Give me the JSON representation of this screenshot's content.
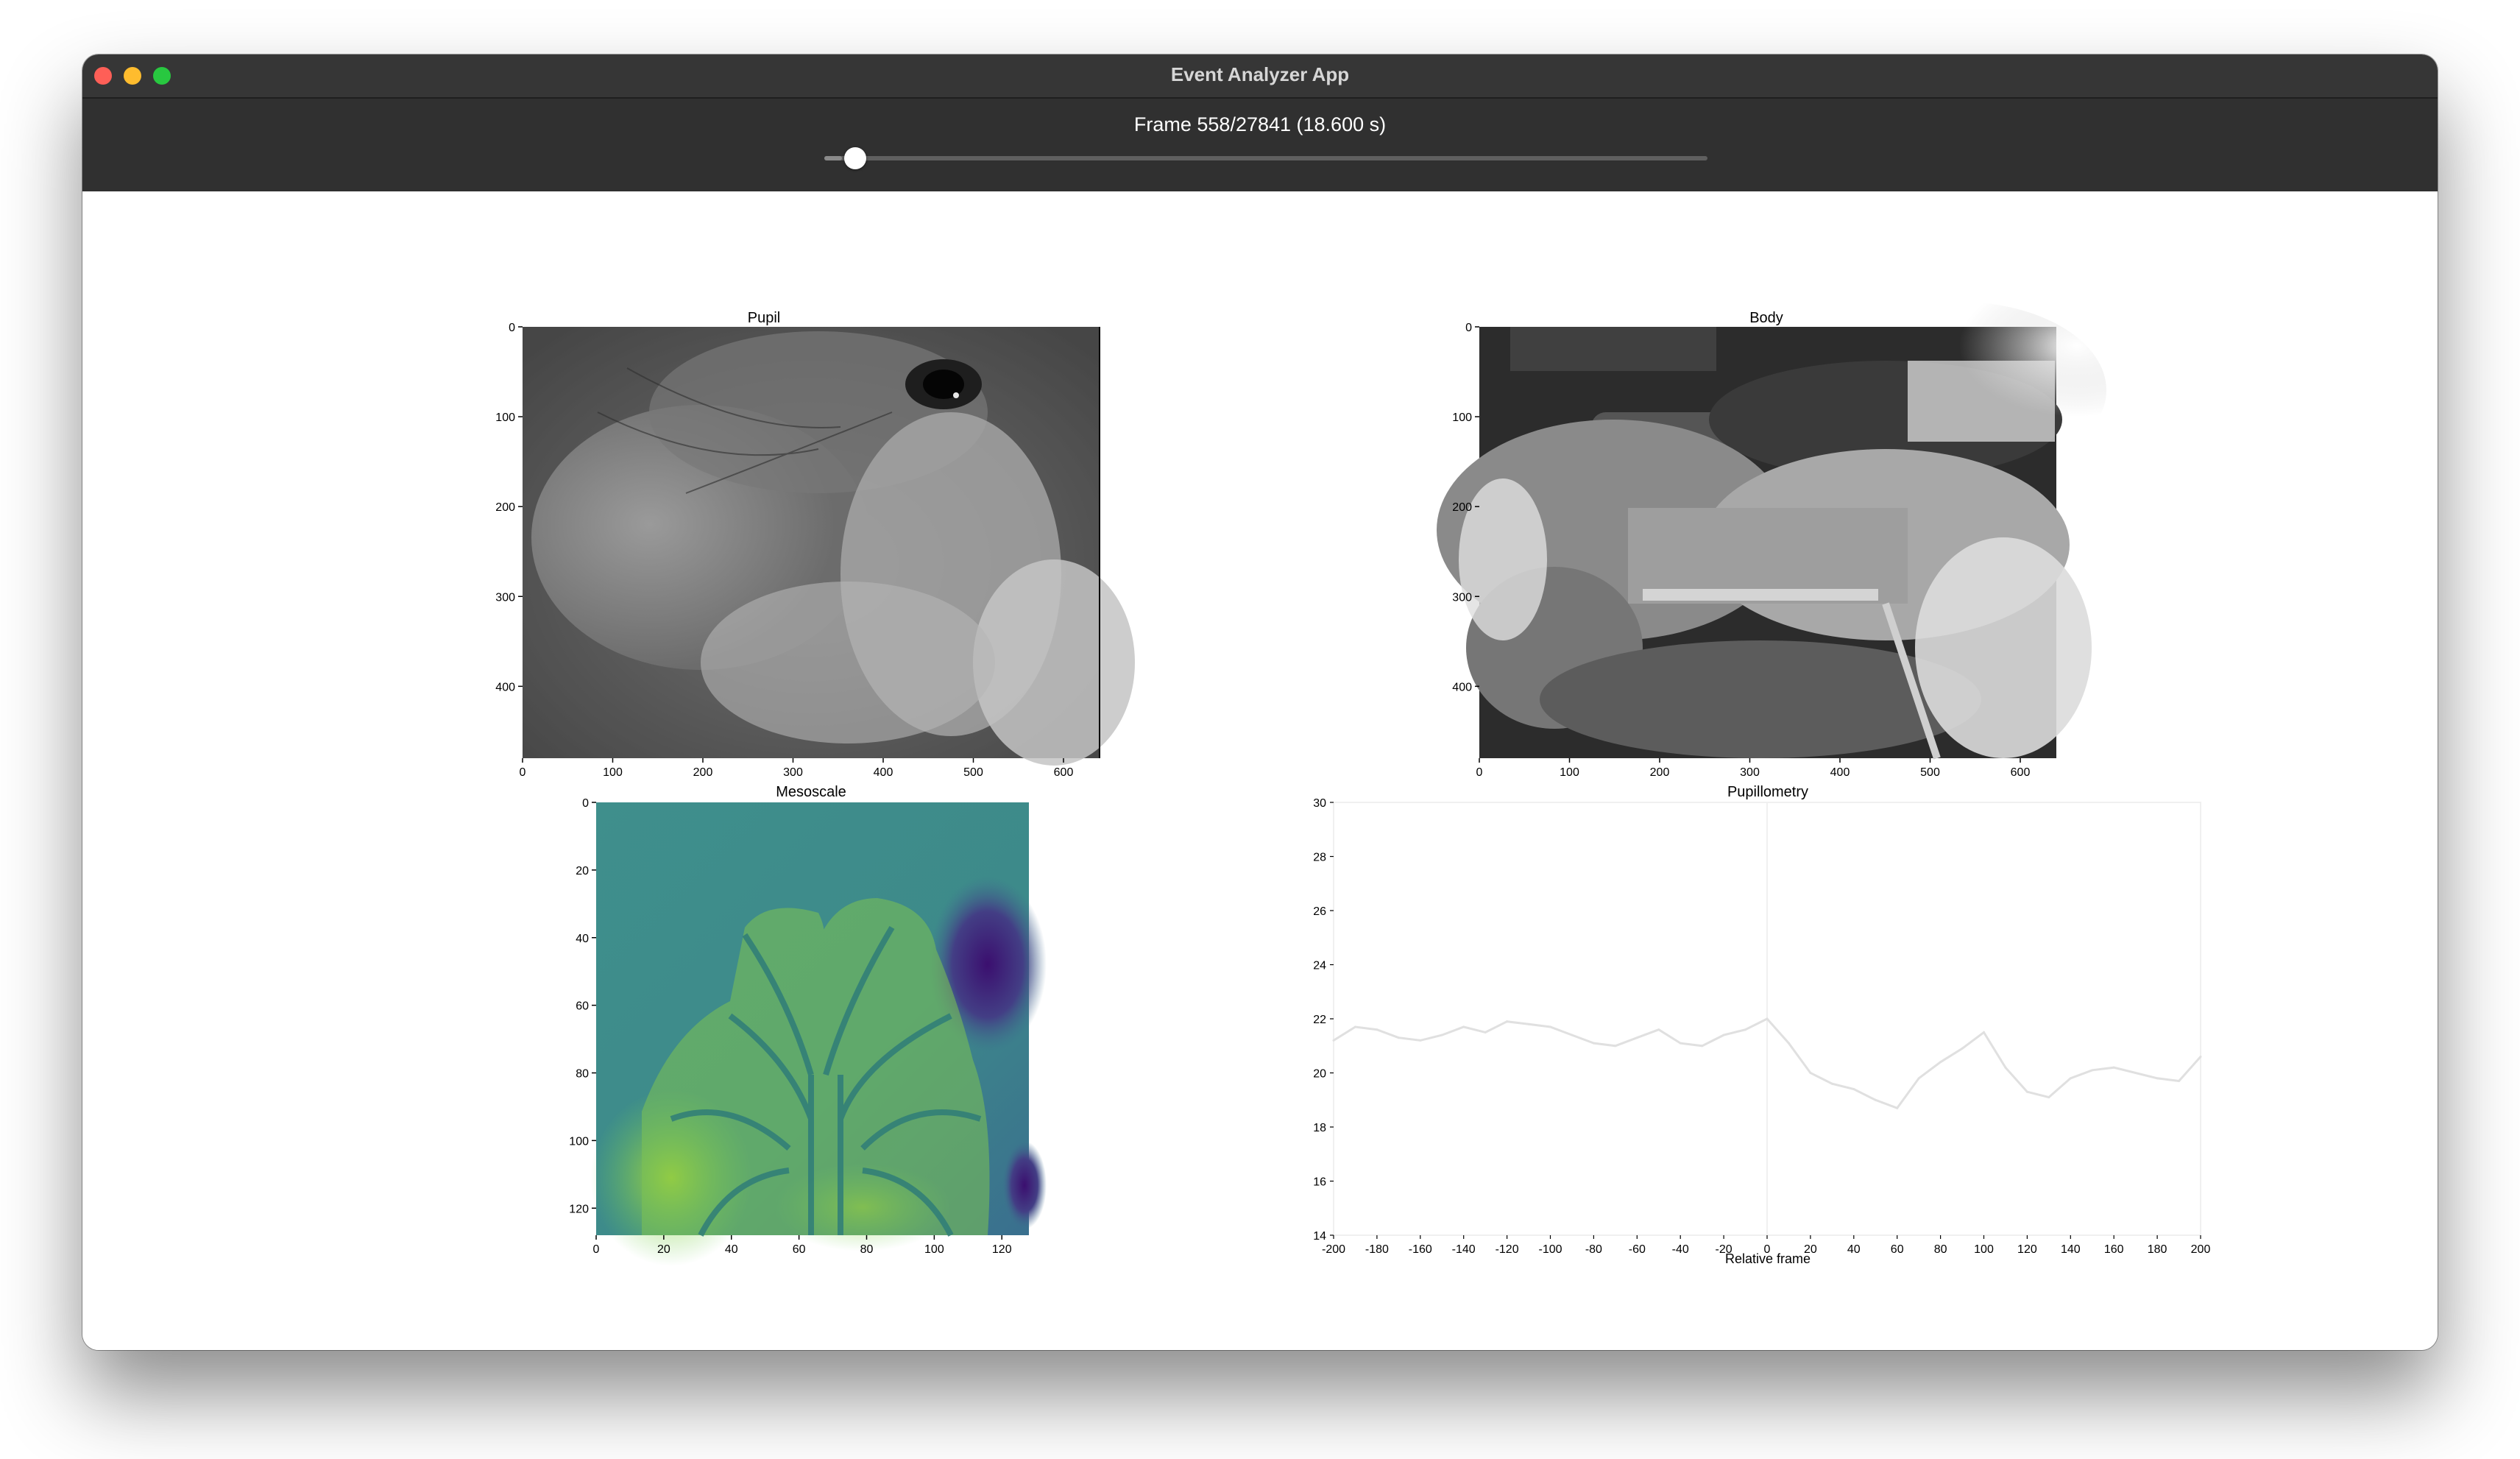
{
  "window": {
    "title": "Event Analyzer App"
  },
  "controls": {
    "frame_label": "Frame 558/27841 (18.600 s)",
    "slider": {
      "current_frame": 558,
      "total_frames": 27841,
      "fraction": 0.02
    }
  },
  "panels": {
    "pupil": {
      "title": "Pupil",
      "xticks": [
        "0",
        "100",
        "200",
        "300",
        "400",
        "500",
        "600"
      ],
      "yticks": [
        "0",
        "100",
        "200",
        "300",
        "400"
      ],
      "xlim": [
        0,
        640
      ],
      "ylim": [
        480,
        0
      ],
      "image": "grayscale close-up of mouse face with eye and whiskers"
    },
    "body": {
      "title": "Body",
      "xticks": [
        "0",
        "100",
        "200",
        "300",
        "400",
        "500",
        "600"
      ],
      "yticks": [
        "0",
        "100",
        "200",
        "300",
        "400"
      ],
      "xlim": [
        0,
        640
      ],
      "ylim": [
        480,
        0
      ],
      "image": "grayscale view of mouse body on running platform"
    },
    "mesoscale": {
      "title": "Mesoscale",
      "xticks": [
        "0",
        "20",
        "40",
        "60",
        "80",
        "100",
        "120"
      ],
      "yticks": [
        "0",
        "20",
        "40",
        "60",
        "80",
        "100",
        "120"
      ],
      "xlim": [
        0,
        128
      ],
      "ylim": [
        128,
        0
      ],
      "image": "viridis colormap cortical activity map with region outlines",
      "colormap": {
        "dark": "#3b0f6f",
        "mid": "#3e8a8a",
        "light": "#b5de2b"
      }
    }
  },
  "chart_data": {
    "type": "line",
    "title": "Pupillometry",
    "xlabel": "Relative frame",
    "ylabel": "",
    "xlim": [
      -200,
      200
    ],
    "ylim": [
      14,
      30
    ],
    "xticks": [
      "-200",
      "-180",
      "-160",
      "-140",
      "-120",
      "-100",
      "-80",
      "-60",
      "-40",
      "-20",
      "0",
      "20",
      "40",
      "60",
      "80",
      "100",
      "120",
      "140",
      "160",
      "180",
      "200"
    ],
    "yticks": [
      "14",
      "16",
      "18",
      "20",
      "22",
      "24",
      "26",
      "28",
      "30"
    ],
    "grid": false,
    "vline_x": 0,
    "line_color": "#e0e0e0",
    "series": [
      {
        "x": [
          -200,
          -190,
          -180,
          -170,
          -160,
          -150,
          -140,
          -130,
          -120,
          -110,
          -100,
          -90,
          -80,
          -70,
          -60,
          -50,
          -40,
          -30,
          -20,
          -10,
          0,
          10,
          20,
          30,
          40,
          50,
          60,
          70,
          80,
          90,
          100,
          110,
          120,
          130,
          140,
          150,
          160,
          170,
          180,
          190,
          200
        ],
        "values": [
          21.2,
          21.7,
          21.6,
          21.3,
          21.2,
          21.4,
          21.7,
          21.5,
          21.9,
          21.8,
          21.7,
          21.4,
          21.1,
          21.0,
          21.3,
          21.6,
          21.1,
          21.0,
          21.4,
          21.6,
          22.0,
          21.1,
          20.0,
          19.6,
          19.4,
          19.0,
          18.7,
          19.8,
          20.4,
          20.9,
          21.5,
          20.2,
          19.3,
          19.1,
          19.8,
          20.1,
          20.2,
          20.0,
          19.8,
          19.7,
          20.6
        ]
      }
    ]
  }
}
